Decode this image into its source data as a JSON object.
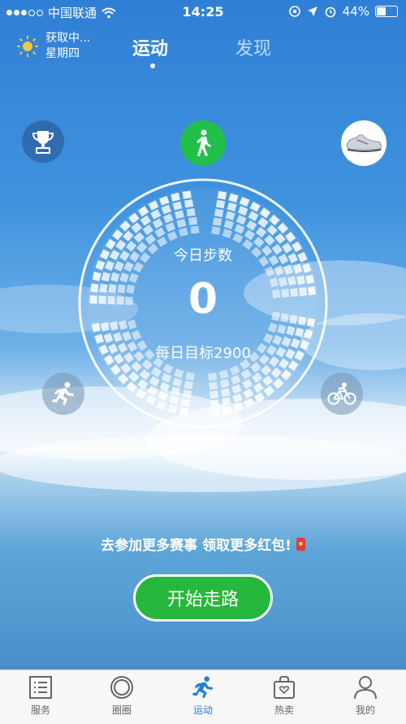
{
  "status_bar": {
    "carrier": "中国联通",
    "time": "14:25",
    "battery": "44%"
  },
  "weather": {
    "status": "获取中...",
    "weekday": "星期四"
  },
  "tabs": [
    {
      "label": "运动",
      "active": true
    },
    {
      "label": "发现",
      "active": false
    }
  ],
  "ring": {
    "label": "今日步数",
    "steps": "0",
    "goal": "每日目标2900"
  },
  "promo": {
    "text": "去参加更多赛事 领取更多红包!"
  },
  "start_button": {
    "label": "开始走路"
  },
  "bottom_nav": [
    {
      "label": "服务",
      "icon": "list-icon",
      "active": false
    },
    {
      "label": "圈圈",
      "icon": "ring-icon",
      "active": false
    },
    {
      "label": "运动",
      "icon": "runner-icon",
      "active": true
    },
    {
      "label": "热卖",
      "icon": "bag-icon",
      "active": false
    },
    {
      "label": "我的",
      "icon": "person-icon",
      "active": false
    }
  ],
  "colors": {
    "accent_green": "#22c04a",
    "active_blue": "#1e7fd8"
  }
}
